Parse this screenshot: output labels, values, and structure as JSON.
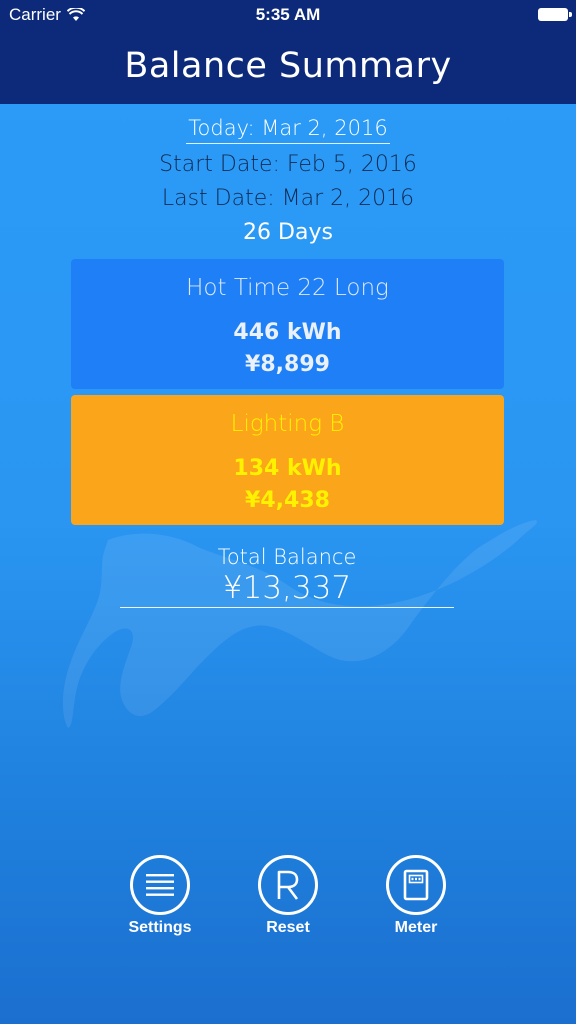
{
  "status_bar": {
    "carrier": "Carrier",
    "time": "5:35 AM"
  },
  "nav": {
    "title": "Balance Summary"
  },
  "summary": {
    "today": "Today: Mar 2, 2016",
    "start_date": "Start Date: Feb 5, 2016",
    "last_date": "Last Date: Mar 2, 2016",
    "days": "26 Days"
  },
  "plans": [
    {
      "name": "Hot Time 22 Long",
      "kwh": "446 kWh",
      "cost": "¥8,899",
      "color": "#1e7ff7"
    },
    {
      "name": "Lighting B",
      "kwh": "134 kWh",
      "cost": "¥4,438",
      "color": "#fba51b"
    }
  ],
  "total": {
    "label": "Total Balance",
    "value": "¥13,337"
  },
  "toolbar": {
    "settings_label": "Settings",
    "reset_label": "Reset",
    "meter_label": "Meter"
  },
  "colors": {
    "nav_bg": "#0d2a7a",
    "page_bg": "#2a96f2",
    "accent_yellow": "#fff200"
  },
  "icons": {
    "settings": "list-lines-icon",
    "reset": "r-letter-icon",
    "meter": "meter-device-icon",
    "wifi": "wifi-icon",
    "battery": "battery-icon"
  }
}
